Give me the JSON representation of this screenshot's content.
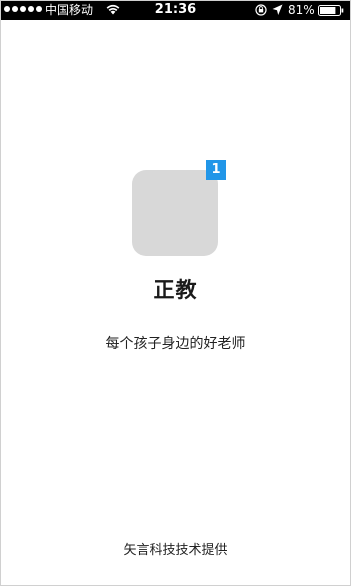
{
  "status_bar": {
    "carrier": "中国移动",
    "time": "21:36",
    "battery_percent": "81%",
    "battery_level": 0.81,
    "icons": [
      "signal-dots",
      "wifi-icon",
      "orientation-lock-icon",
      "location-arrow-icon",
      "battery-icon"
    ]
  },
  "splash": {
    "app_icon": "app-icon-placeholder",
    "badge_count": "1",
    "badge_color": "#2196e8",
    "app_name": "正教",
    "tagline": "每个孩子身边的好老师",
    "credit": "矢言科技技术提供"
  }
}
